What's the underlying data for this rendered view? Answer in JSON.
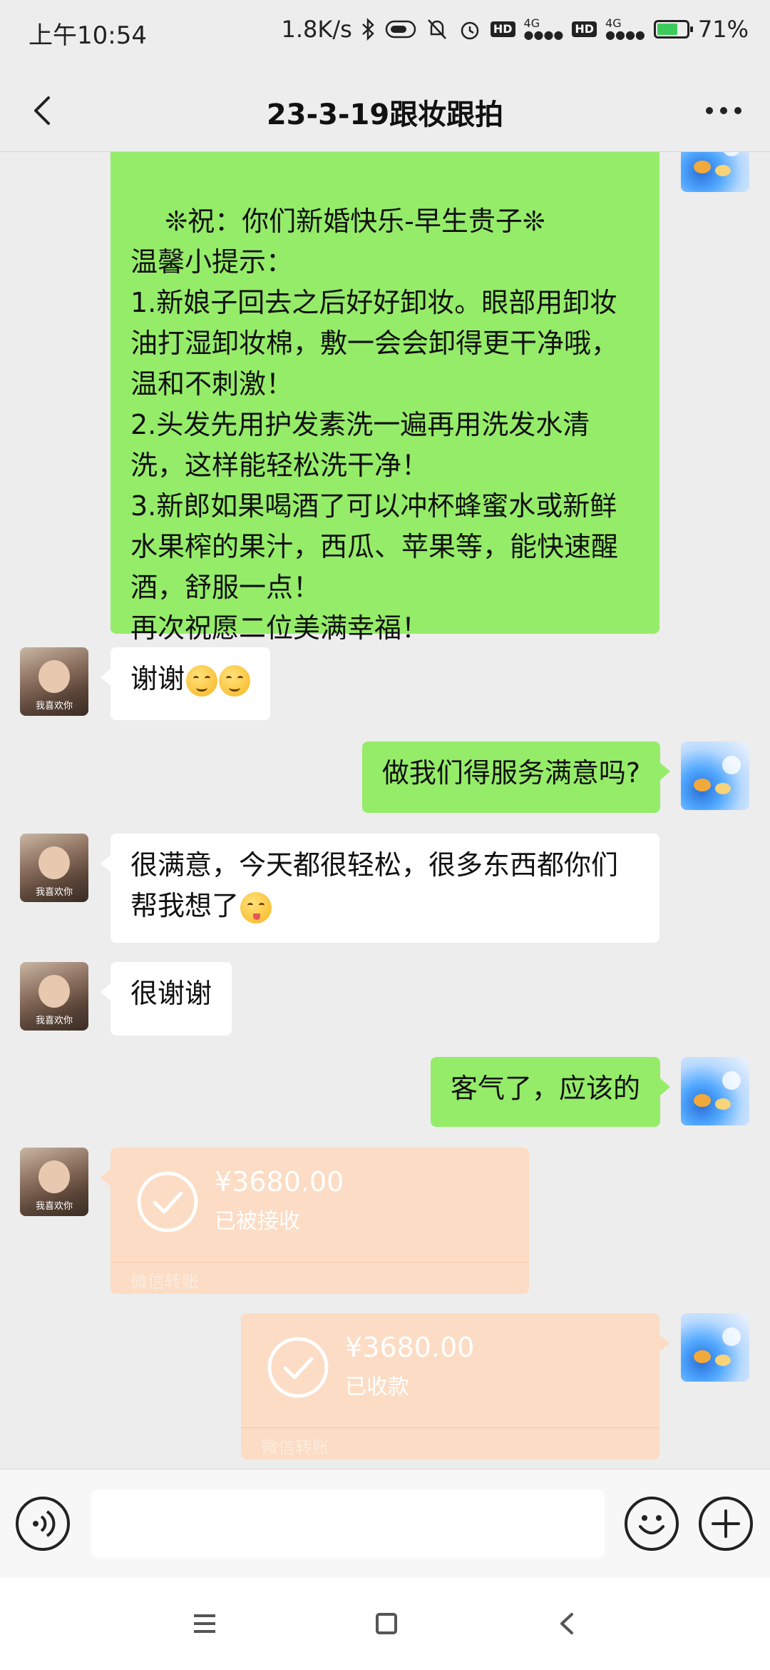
{
  "status_bar": {
    "time": "上午10:54",
    "net_speed": "1.8K/s",
    "hd1": "HD",
    "sig1": "4G",
    "hd2": "HD",
    "sig2": "4G",
    "battery_text": "71%",
    "battery_level": 0.71
  },
  "header": {
    "title": "23-3-19跟妆跟拍"
  },
  "messages": [
    {
      "side": "right",
      "text": "❊祝：你们新婚快乐-早生贵子❊\n温馨小提示：\n1.新娘子回去之后好好卸妆。眼部用卸妆油打湿卸妆棉，敷一会会卸得更干净哦，温和不刺激！\n2.头发先用护发素洗一遍再用洗发水清洗，这样能轻松洗干净！\n3.新郎如果喝酒了可以冲杯蜂蜜水或新鲜水果榨的果汁，西瓜、苹果等，能快速醒酒，舒服一点！\n再次祝愿二位美满幸福！"
    },
    {
      "side": "left",
      "text": "谢谢"
    },
    {
      "side": "right",
      "text": "做我们得服务满意吗?"
    },
    {
      "side": "left",
      "text": "很满意，今天都很轻松，很多东西都你们帮我想了"
    },
    {
      "side": "left",
      "text": "很谢谢"
    },
    {
      "side": "right",
      "text": "客气了，应该的"
    }
  ],
  "avatars": {
    "friend_caption": "我喜欢你"
  },
  "transfers": [
    {
      "side": "left",
      "amount": "¥3680.00",
      "status": "已被接收",
      "footer": "微信转账"
    },
    {
      "side": "right",
      "amount": "¥3680.00",
      "status": "已收款",
      "footer": "微信转账"
    }
  ],
  "input": {
    "placeholder": ""
  },
  "colors": {
    "chat_bg": "#ededed",
    "green_bubble": "#95ec69",
    "white_bubble": "#ffffff",
    "transfer_bg": "#fcdcc4"
  }
}
